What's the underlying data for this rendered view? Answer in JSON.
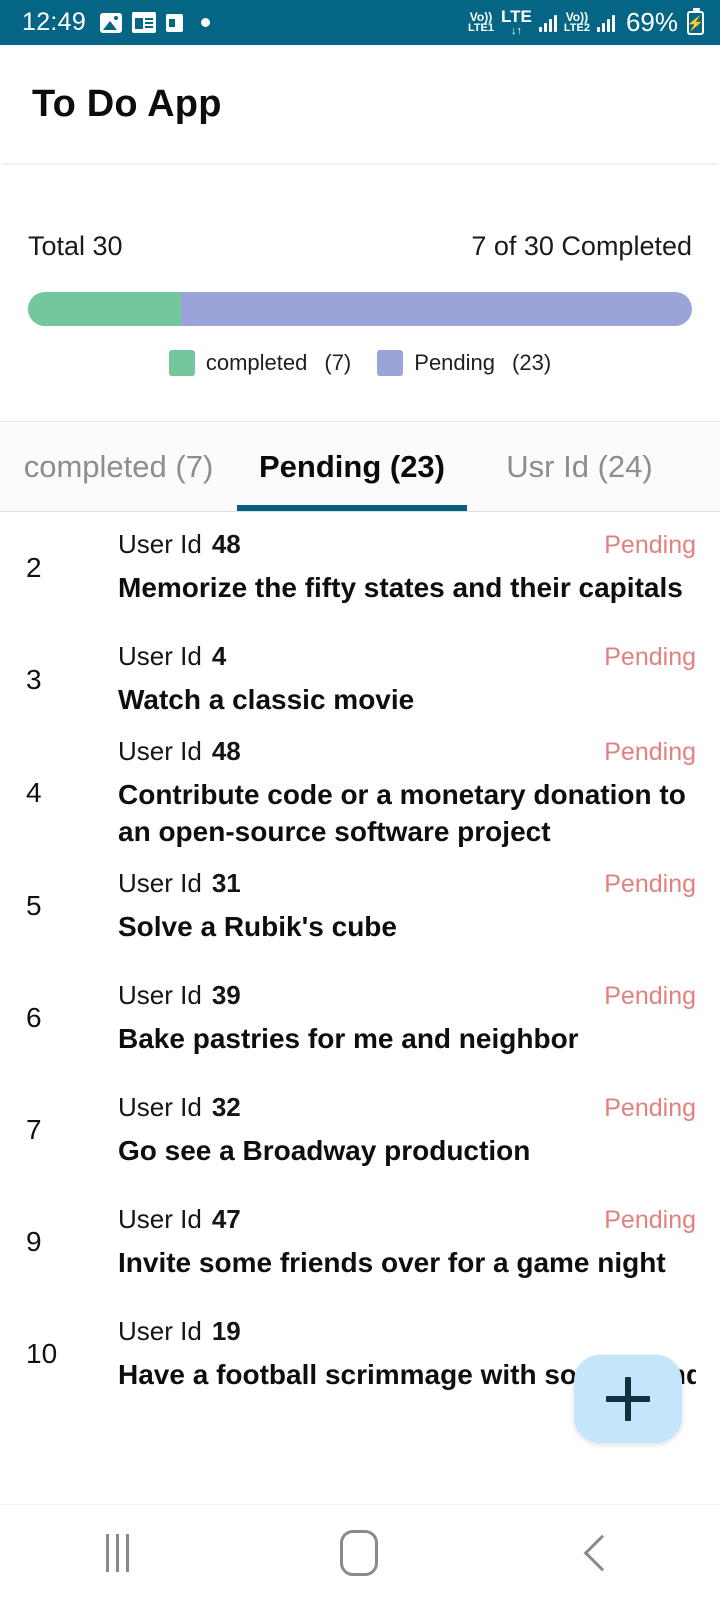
{
  "status_bar": {
    "time": "12:49",
    "icons_left": [
      "image-icon",
      "news-icon",
      "camera-icon",
      "dot-icon"
    ],
    "network": {
      "volte1_top": "Vo))",
      "volte1_bottom": "LTE1",
      "lte_label": "LTE",
      "lte_arrows": "↓↑",
      "volte2_top": "Vo))",
      "volte2_bottom": "LTE2"
    },
    "battery_percent": "69%",
    "battery_glyph": "⚡",
    "background_color": "#046684"
  },
  "appbar": {
    "title": "To Do App"
  },
  "summary": {
    "total_label": "Total 30",
    "completed_label": "7 of 30 Completed",
    "progress_percent": 23,
    "completed_color": "#74c79c",
    "pending_color": "#9ba4d9",
    "legend": [
      {
        "label": "completed",
        "count": "(7)",
        "color": "#74c79c"
      },
      {
        "label": "Pending",
        "count": "(23)",
        "color": "#9ba4d9"
      }
    ]
  },
  "tabs": {
    "active_index": 1,
    "indicator_color": "#046280",
    "items": [
      {
        "label": "completed (7)"
      },
      {
        "label": "Pending (23)"
      },
      {
        "label": "Usr Id (24)"
      },
      {
        "label": ""
      }
    ]
  },
  "list": {
    "status_color": "#e38080",
    "user_id_prefix": "User Id",
    "rows": [
      {
        "index": "2",
        "user_id": "48",
        "status": "Pending",
        "title": "Memorize the fifty states and their capitals"
      },
      {
        "index": "3",
        "user_id": "4",
        "status": "Pending",
        "title": "Watch a classic movie"
      },
      {
        "index": "4",
        "user_id": "48",
        "status": "Pending",
        "title": "Contribute code or a monetary donation to an open-source software project"
      },
      {
        "index": "5",
        "user_id": "31",
        "status": "Pending",
        "title": "Solve a Rubik's cube"
      },
      {
        "index": "6",
        "user_id": "39",
        "status": "Pending",
        "title": "Bake pastries for me and neighbor"
      },
      {
        "index": "7",
        "user_id": "32",
        "status": "Pending",
        "title": "Go see a Broadway production"
      },
      {
        "index": "9",
        "user_id": "47",
        "status": "Pending",
        "title": "Invite some friends over for a game night"
      },
      {
        "index": "10",
        "user_id": "19",
        "status": "",
        "title": "Have a football scrimmage with some friends"
      }
    ]
  },
  "fab": {
    "icon": "plus-icon",
    "background_color": "#c3e6fb"
  },
  "navbar": {
    "recents": "recents-icon",
    "home": "home-icon",
    "back": "back-icon"
  }
}
